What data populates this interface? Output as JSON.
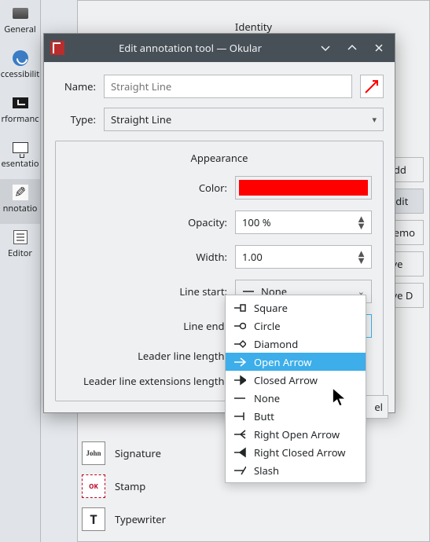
{
  "bg": {
    "sidebar": [
      "General",
      "ccessibilit",
      "rformanc",
      "esentatio",
      "nnotatio",
      "Editor"
    ],
    "identity": "Identity",
    "buttons": [
      "Add",
      "Edit",
      "Remo",
      "Move",
      "Move D"
    ],
    "list": [
      "Signature",
      "Stamp",
      "Typewriter"
    ]
  },
  "dialog": {
    "title": "Edit annotation tool — Okular",
    "name_label": "Name:",
    "name_placeholder": "Straight Line",
    "type_label": "Type:",
    "type_value": "Straight Line",
    "group_title": "Appearance",
    "props": {
      "color_label": "Color:",
      "color_value": "#ff0000",
      "opacity_label": "Opacity:",
      "opacity_value": "100 %",
      "width_label": "Width:",
      "width_value": "1.00",
      "linestart_label": "Line start:",
      "linestart_value": "None",
      "lineend_label": "Line end:",
      "lineend_value": "Open Arrow",
      "leader_label": "Leader line length:",
      "leaderext_label": "Leader line extensions length:"
    },
    "cancel_peek": "el"
  },
  "dropdown": {
    "options": [
      {
        "glyph": "square",
        "label": "Square"
      },
      {
        "glyph": "circle",
        "label": "Circle"
      },
      {
        "glyph": "diamond",
        "label": "Diamond"
      },
      {
        "glyph": "openarrow",
        "label": "Open Arrow"
      },
      {
        "glyph": "closedarrow",
        "label": "Closed Arrow"
      },
      {
        "glyph": "none",
        "label": "None"
      },
      {
        "glyph": "butt",
        "label": "Butt"
      },
      {
        "glyph": "ropenarrow",
        "label": "Right Open Arrow"
      },
      {
        "glyph": "rclosedarrow",
        "label": "Right Closed Arrow"
      },
      {
        "glyph": "slash",
        "label": "Slash"
      }
    ],
    "highlighted": 3
  }
}
